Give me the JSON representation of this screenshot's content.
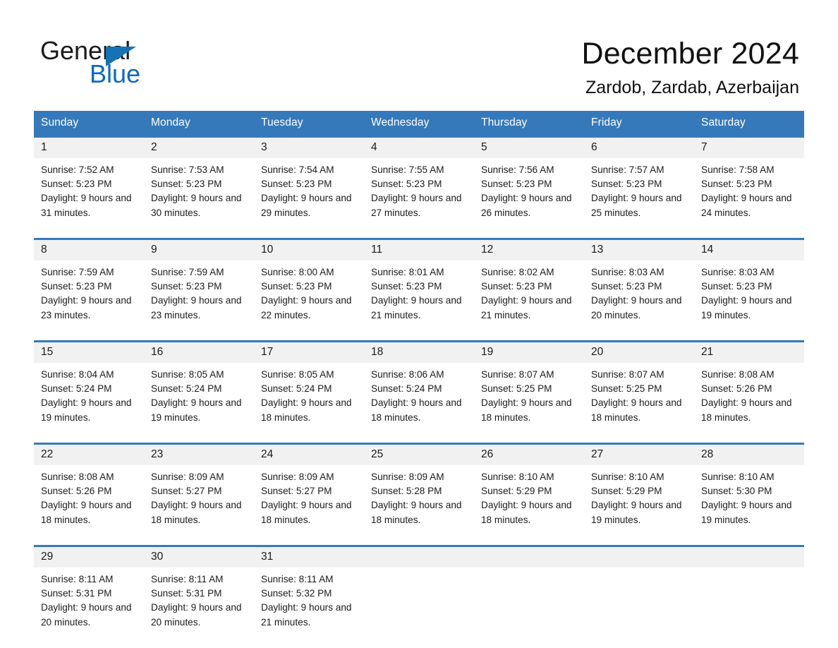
{
  "logo": {
    "text_primary": "General",
    "text_secondary": "Blue",
    "primary_color": "#1a1a1a",
    "secondary_color": "#0b69c7",
    "triangle_color": "#1572b6"
  },
  "header": {
    "month_title": "December 2024",
    "location": "Zardob, Zardab, Azerbaijan"
  },
  "theme": {
    "header_blue": "#3579ba",
    "daynum_band": "#f1f1f1",
    "page_background": "#ffffff",
    "text": "#1a1a1a"
  },
  "weekdays": [
    "Sunday",
    "Monday",
    "Tuesday",
    "Wednesday",
    "Thursday",
    "Friday",
    "Saturday"
  ],
  "weeks": [
    {
      "days": [
        {
          "day": "1",
          "sunrise": "Sunrise: 7:52 AM",
          "sunset": "Sunset: 5:23 PM",
          "daylight": "Daylight: 9 hours and 31 minutes."
        },
        {
          "day": "2",
          "sunrise": "Sunrise: 7:53 AM",
          "sunset": "Sunset: 5:23 PM",
          "daylight": "Daylight: 9 hours and 30 minutes."
        },
        {
          "day": "3",
          "sunrise": "Sunrise: 7:54 AM",
          "sunset": "Sunset: 5:23 PM",
          "daylight": "Daylight: 9 hours and 29 minutes."
        },
        {
          "day": "4",
          "sunrise": "Sunrise: 7:55 AM",
          "sunset": "Sunset: 5:23 PM",
          "daylight": "Daylight: 9 hours and 27 minutes."
        },
        {
          "day": "5",
          "sunrise": "Sunrise: 7:56 AM",
          "sunset": "Sunset: 5:23 PM",
          "daylight": "Daylight: 9 hours and 26 minutes."
        },
        {
          "day": "6",
          "sunrise": "Sunrise: 7:57 AM",
          "sunset": "Sunset: 5:23 PM",
          "daylight": "Daylight: 9 hours and 25 minutes."
        },
        {
          "day": "7",
          "sunrise": "Sunrise: 7:58 AM",
          "sunset": "Sunset: 5:23 PM",
          "daylight": "Daylight: 9 hours and 24 minutes."
        }
      ]
    },
    {
      "days": [
        {
          "day": "8",
          "sunrise": "Sunrise: 7:59 AM",
          "sunset": "Sunset: 5:23 PM",
          "daylight": "Daylight: 9 hours and 23 minutes."
        },
        {
          "day": "9",
          "sunrise": "Sunrise: 7:59 AM",
          "sunset": "Sunset: 5:23 PM",
          "daylight": "Daylight: 9 hours and 23 minutes."
        },
        {
          "day": "10",
          "sunrise": "Sunrise: 8:00 AM",
          "sunset": "Sunset: 5:23 PM",
          "daylight": "Daylight: 9 hours and 22 minutes."
        },
        {
          "day": "11",
          "sunrise": "Sunrise: 8:01 AM",
          "sunset": "Sunset: 5:23 PM",
          "daylight": "Daylight: 9 hours and 21 minutes."
        },
        {
          "day": "12",
          "sunrise": "Sunrise: 8:02 AM",
          "sunset": "Sunset: 5:23 PM",
          "daylight": "Daylight: 9 hours and 21 minutes."
        },
        {
          "day": "13",
          "sunrise": "Sunrise: 8:03 AM",
          "sunset": "Sunset: 5:23 PM",
          "daylight": "Daylight: 9 hours and 20 minutes."
        },
        {
          "day": "14",
          "sunrise": "Sunrise: 8:03 AM",
          "sunset": "Sunset: 5:23 PM",
          "daylight": "Daylight: 9 hours and 19 minutes."
        }
      ]
    },
    {
      "days": [
        {
          "day": "15",
          "sunrise": "Sunrise: 8:04 AM",
          "sunset": "Sunset: 5:24 PM",
          "daylight": "Daylight: 9 hours and 19 minutes."
        },
        {
          "day": "16",
          "sunrise": "Sunrise: 8:05 AM",
          "sunset": "Sunset: 5:24 PM",
          "daylight": "Daylight: 9 hours and 19 minutes."
        },
        {
          "day": "17",
          "sunrise": "Sunrise: 8:05 AM",
          "sunset": "Sunset: 5:24 PM",
          "daylight": "Daylight: 9 hours and 18 minutes."
        },
        {
          "day": "18",
          "sunrise": "Sunrise: 8:06 AM",
          "sunset": "Sunset: 5:24 PM",
          "daylight": "Daylight: 9 hours and 18 minutes."
        },
        {
          "day": "19",
          "sunrise": "Sunrise: 8:07 AM",
          "sunset": "Sunset: 5:25 PM",
          "daylight": "Daylight: 9 hours and 18 minutes."
        },
        {
          "day": "20",
          "sunrise": "Sunrise: 8:07 AM",
          "sunset": "Sunset: 5:25 PM",
          "daylight": "Daylight: 9 hours and 18 minutes."
        },
        {
          "day": "21",
          "sunrise": "Sunrise: 8:08 AM",
          "sunset": "Sunset: 5:26 PM",
          "daylight": "Daylight: 9 hours and 18 minutes."
        }
      ]
    },
    {
      "days": [
        {
          "day": "22",
          "sunrise": "Sunrise: 8:08 AM",
          "sunset": "Sunset: 5:26 PM",
          "daylight": "Daylight: 9 hours and 18 minutes."
        },
        {
          "day": "23",
          "sunrise": "Sunrise: 8:09 AM",
          "sunset": "Sunset: 5:27 PM",
          "daylight": "Daylight: 9 hours and 18 minutes."
        },
        {
          "day": "24",
          "sunrise": "Sunrise: 8:09 AM",
          "sunset": "Sunset: 5:27 PM",
          "daylight": "Daylight: 9 hours and 18 minutes."
        },
        {
          "day": "25",
          "sunrise": "Sunrise: 8:09 AM",
          "sunset": "Sunset: 5:28 PM",
          "daylight": "Daylight: 9 hours and 18 minutes."
        },
        {
          "day": "26",
          "sunrise": "Sunrise: 8:10 AM",
          "sunset": "Sunset: 5:29 PM",
          "daylight": "Daylight: 9 hours and 18 minutes."
        },
        {
          "day": "27",
          "sunrise": "Sunrise: 8:10 AM",
          "sunset": "Sunset: 5:29 PM",
          "daylight": "Daylight: 9 hours and 19 minutes."
        },
        {
          "day": "28",
          "sunrise": "Sunrise: 8:10 AM",
          "sunset": "Sunset: 5:30 PM",
          "daylight": "Daylight: 9 hours and 19 minutes."
        }
      ]
    },
    {
      "days": [
        {
          "day": "29",
          "sunrise": "Sunrise: 8:11 AM",
          "sunset": "Sunset: 5:31 PM",
          "daylight": "Daylight: 9 hours and 20 minutes."
        },
        {
          "day": "30",
          "sunrise": "Sunrise: 8:11 AM",
          "sunset": "Sunset: 5:31 PM",
          "daylight": "Daylight: 9 hours and 20 minutes."
        },
        {
          "day": "31",
          "sunrise": "Sunrise: 8:11 AM",
          "sunset": "Sunset: 5:32 PM",
          "daylight": "Daylight: 9 hours and 21 minutes."
        },
        {
          "day": "",
          "sunrise": "",
          "sunset": "",
          "daylight": ""
        },
        {
          "day": "",
          "sunrise": "",
          "sunset": "",
          "daylight": ""
        },
        {
          "day": "",
          "sunrise": "",
          "sunset": "",
          "daylight": ""
        },
        {
          "day": "",
          "sunrise": "",
          "sunset": "",
          "daylight": ""
        }
      ]
    }
  ]
}
